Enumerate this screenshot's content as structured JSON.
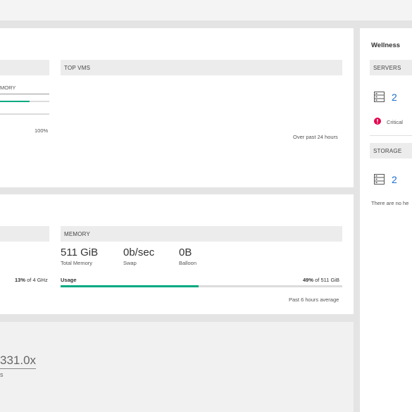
{
  "utilization_card": {
    "left_header": "",
    "memory_partial_label": "MORY",
    "memory_bar_fraction": 0.6,
    "scale_max": "100%",
    "top_vms_header": "TOP VMS",
    "top_vms_footer": "Over past 24 hours"
  },
  "performance_card": {
    "cpu_header": "",
    "cpu_usage_value": "13%",
    "cpu_usage_suffix": " of 4 GHz",
    "memory_header": "MEMORY",
    "total_memory_value": "511 GiB",
    "total_memory_label": "Total Memory",
    "swap_value": "0b/sec",
    "swap_label": "Swap",
    "balloon_value": "0B",
    "balloon_label": "Balloon",
    "usage_label": "Usage",
    "usage_percent": "49%",
    "usage_suffix": " of 511 GiB",
    "usage_fraction": 0.49,
    "footer": "Past 6 hours average"
  },
  "efficiency_card": {
    "ratio_value": "331.0x",
    "ratio_label_partial": "s"
  },
  "wellness": {
    "title": "Wellness",
    "servers_header": "SERVERS",
    "servers_count": "2",
    "servers_icon": "server-icon",
    "critical_label": "Critical",
    "critical_icon": "alert-icon",
    "critical_color": "#e5004c",
    "storage_header": "STORAGE",
    "storage_count": "2",
    "storage_icon": "storage-icon",
    "storage_status": "There are no he"
  },
  "colors": {
    "accent": "#01a982",
    "link": "#1a6fd0"
  }
}
